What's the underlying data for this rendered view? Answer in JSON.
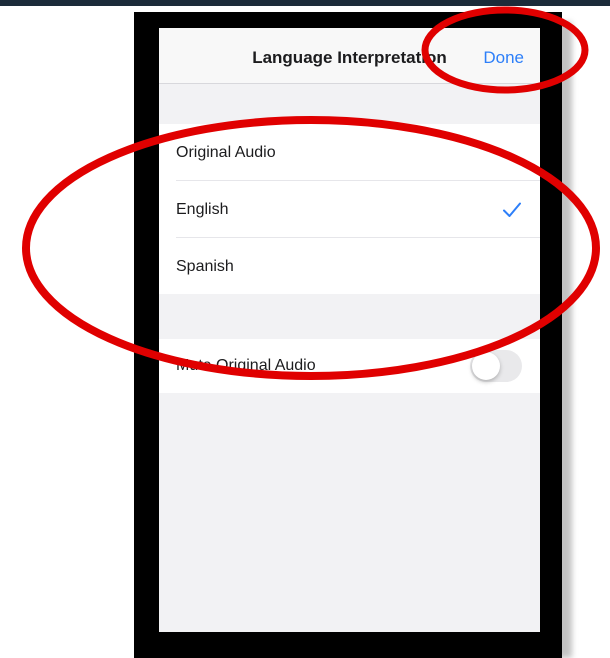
{
  "header": {
    "title": "Language Interpretation",
    "done_label": "Done"
  },
  "languages": {
    "items": [
      {
        "label": "Original Audio",
        "selected": false
      },
      {
        "label": "English",
        "selected": true
      },
      {
        "label": "Spanish",
        "selected": false
      }
    ]
  },
  "mute": {
    "label": "Mute Original Audio",
    "enabled": false
  },
  "colors": {
    "accent": "#2d7ff9",
    "annotation": "#e00000",
    "frame": "#000000",
    "background": "#f2f2f4"
  }
}
